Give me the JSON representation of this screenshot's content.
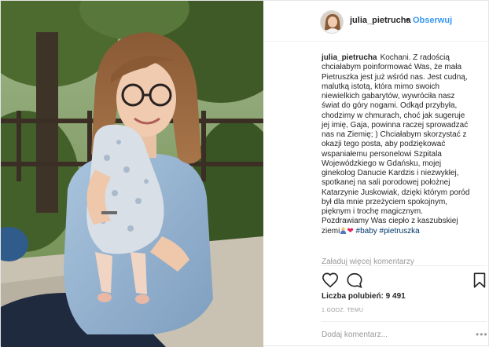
{
  "header": {
    "username": "julia_pietrucha",
    "separator": "•",
    "follow_label": "Obserwuj"
  },
  "caption": {
    "username": "julia_pietrucha",
    "lines": [
      "Kochani. Z radością",
      "chciałabym poinformować Was, że mała",
      "Pietruszka jest już wśród nas. Jest cudną,",
      "malutką istotą, która mimo swoich",
      "niewielkich gabarytów, wywróciła nasz",
      "świat do góry nogami. Odkąd przybyła,",
      "chodzimy w chmurach, choć jak sugeruje",
      "jej imię, Gaja, powinna raczej sprowadzać",
      "nas na Ziemię; ) Chciałabym skorzystać z",
      "okazji tego posta, aby podziękować",
      "wspaniałemu personelowi Szpitala",
      "Wojewódzkiego w Gdańsku, mojej",
      "ginekolog Danucie Kardzis i niezwykłej,",
      "spotkanej na sali porodowej położnej",
      "Katarzynie Juskowiak, dzięki którym poród",
      "był dla mnie przeżyciem spokojnym,",
      "pięknym i trochę magicznym.",
      "Pozdrawiamy Was ciepło z kaszubskiej",
      "ziemi"
    ],
    "heart": "❤",
    "hashtags": [
      "#baby",
      "#pietruszka"
    ]
  },
  "load_more_label": "Załaduj więcej komentarzy",
  "likes_text": "Liczba polubień: 9 491",
  "timestamp": "1 GODZ. TEMU",
  "comment": {
    "placeholder": "Dodaj komentarz...",
    "more_label": "•••"
  },
  "icons": {
    "like": "heart-outline-icon",
    "comment": "speech-bubble-icon",
    "save": "bookmark-icon"
  }
}
